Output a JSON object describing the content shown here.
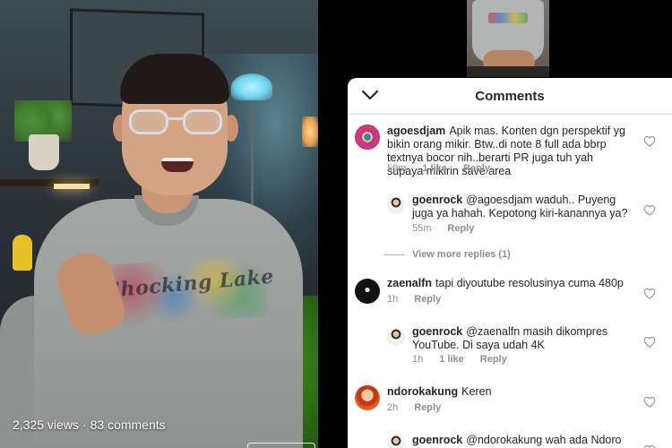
{
  "video": {
    "views": "2,325 views",
    "separator": "·",
    "comments_count": "83 comments",
    "shirt_print": "Shocking Lake"
  },
  "panel": {
    "title": "Comments",
    "back_icon": "chevron-down-icon",
    "view_more": "View more replies (1)"
  },
  "comments": [
    {
      "user": "agoesdjam",
      "text": "Apik mas. Konten dgn perspektif yg bikin orang mikir. Btw..di note 8 full ada bbrp textnya bocor nih..berarti PR juga tuh yah supaya mikirin save area",
      "time": "59m",
      "likes": "1 like",
      "reply": "Reply"
    },
    {
      "user": "goenrock",
      "text": "@agoesdjam waduh.. Puyeng juga ya hahah. Kepotong kiri-kanannya ya?",
      "time": "55m",
      "likes": "",
      "reply": "Reply"
    },
    {
      "user": "zaenalfn",
      "text": "tapi diyoutube resolusinya cuma 480p",
      "time": "1h",
      "likes": "",
      "reply": "Reply"
    },
    {
      "user": "goenrock",
      "text": "@zaenalfn masih dikompres YouTube. Di saya udah 4K",
      "time": "1h",
      "likes": "1 like",
      "reply": "Reply"
    },
    {
      "user": "ndorokakung",
      "text": "Keren",
      "time": "2h",
      "likes": "",
      "reply": "Reply"
    },
    {
      "user": "goenrock",
      "text": "@ndorokakung wah ada Ndoro 🙏🏻",
      "time": "",
      "likes": "",
      "reply": ""
    }
  ],
  "colors": {
    "panel_bg": "#ffffff",
    "text": "#262626",
    "meta": "#8e8e8e",
    "divider": "#dbdbdb"
  }
}
